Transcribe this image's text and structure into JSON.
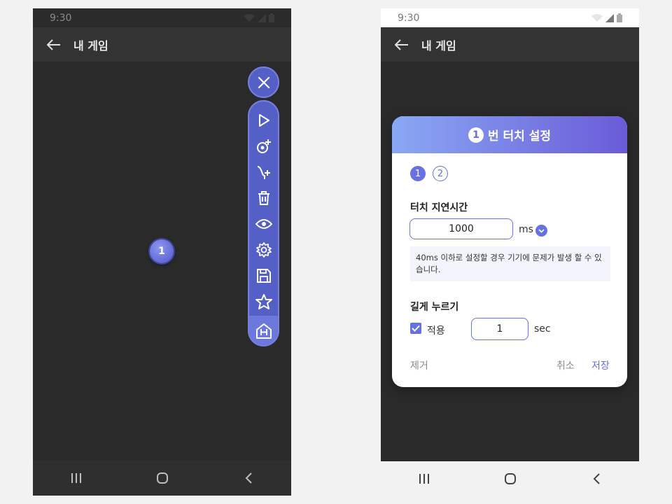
{
  "status": {
    "time": "9:30"
  },
  "appbar": {
    "title": "내 게임"
  },
  "toolbar": {
    "tools": [
      {
        "name": "play-icon"
      },
      {
        "name": "add-touch-icon"
      },
      {
        "name": "add-swipe-icon"
      },
      {
        "name": "trash-icon"
      },
      {
        "name": "eye-icon"
      },
      {
        "name": "gear-icon"
      },
      {
        "name": "save-icon"
      },
      {
        "name": "star-icon"
      },
      {
        "name": "home-h-icon"
      }
    ]
  },
  "touch_point": {
    "label": "1"
  },
  "dialog": {
    "header_num": "1",
    "title": "번 터치 설정",
    "steps": [
      "1",
      "2"
    ],
    "delay_label": "터치 지연시간",
    "delay_value": "1000",
    "delay_unit": "ms",
    "warning": "40ms 이하로 설정할 경우 기기에 문제가 발생 할 수 있습니다.",
    "long_press_label": "길게 누르기",
    "apply_label": "적용",
    "apply_checked": true,
    "long_press_value": "1",
    "long_press_unit": "sec",
    "remove_label": "제거",
    "cancel_label": "취소",
    "save_label": "저장"
  },
  "colors": {
    "accent": "#6671e3",
    "toolbar": "#5560c6",
    "bg_dark": "#2a2a2a"
  }
}
